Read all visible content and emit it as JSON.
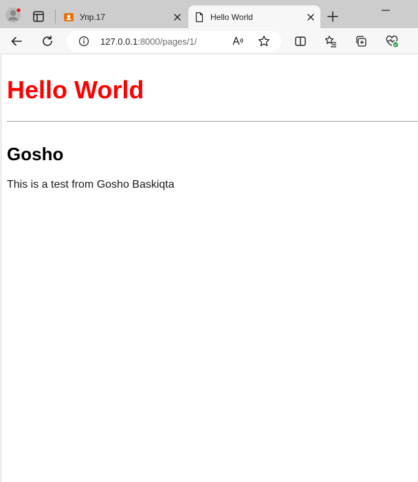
{
  "browser": {
    "tabs": [
      {
        "title": "Упр.17",
        "active": false,
        "favicon": "contact-card-icon",
        "favicon_color": "#e8710a"
      },
      {
        "title": "Hello World",
        "active": true,
        "favicon": "page-icon"
      }
    ],
    "address_bar": {
      "host": "127.0.0.1",
      "path": ":8000/pages/1/"
    }
  },
  "page": {
    "heading": "Hello World",
    "heading_color": "#ff0000",
    "subheading": "Gosho",
    "body_text": "This is a test from Gosho Baskiqta"
  }
}
